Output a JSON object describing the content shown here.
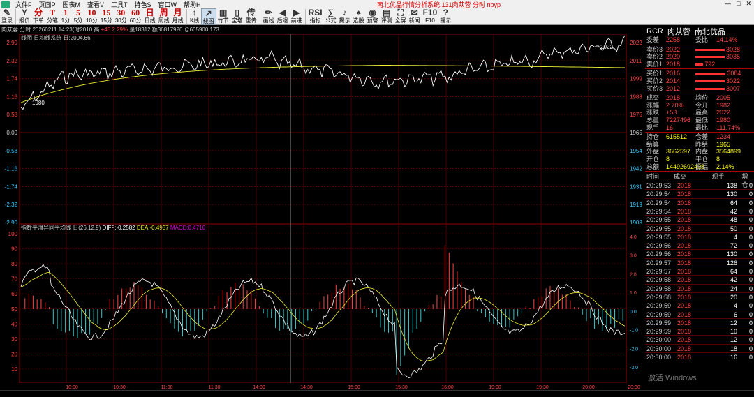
{
  "menu": [
    "文件F",
    "页面P",
    "图表M",
    "查看V",
    "工具T",
    "特色S",
    "窗口W",
    "帮助H"
  ],
  "window_title": "南北优品行情分析系统.131肉苁蓉 分时 nbyp",
  "toolbar": [
    {
      "g": "✎",
      "l": "登录"
    },
    {
      "g": "Y",
      "l": "报价"
    },
    {
      "g": "分",
      "l": "下单",
      "c": "red"
    },
    {
      "g": "T",
      "l": "分笔",
      "c": "red"
    },
    {
      "g": "1",
      "l": "1分",
      "c": "red"
    },
    {
      "g": "5",
      "l": "5分",
      "c": "red"
    },
    {
      "g": "10",
      "l": "10分",
      "c": "red"
    },
    {
      "g": "15",
      "l": "15分",
      "c": "red"
    },
    {
      "g": "30",
      "l": "30分",
      "c": "red"
    },
    {
      "g": "60",
      "l": "60分",
      "c": "red"
    },
    {
      "g": "日",
      "l": "日线",
      "c": "red"
    },
    {
      "g": "周",
      "l": "周线",
      "c": "red"
    },
    {
      "g": "月",
      "l": "月线",
      "c": "red"
    },
    {
      "g": "↕",
      "l": "K线"
    },
    {
      "g": "↗",
      "l": "线图",
      "a": 1
    },
    {
      "g": "▥",
      "l": "竹节"
    },
    {
      "g": "▯",
      "l": "宝塔"
    },
    {
      "g": "传",
      "l": "重传"
    },
    {
      "g": "✏",
      "l": "画线"
    },
    {
      "g": "◀",
      "l": "后退"
    },
    {
      "g": "▶",
      "l": "前进"
    },
    {
      "g": "RSI",
      "l": "指标"
    },
    {
      "g": "∑",
      "l": "公式"
    },
    {
      "g": "♪",
      "l": "提示"
    },
    {
      "g": "♠",
      "l": "选股"
    },
    {
      "g": "◉",
      "l": "预警"
    },
    {
      "g": "▤",
      "l": "评测"
    },
    {
      "g": "⛶",
      "l": "全屏"
    },
    {
      "g": "✉",
      "l": "新闻"
    },
    {
      "g": "F10",
      "l": "F10"
    },
    {
      "g": "?",
      "l": "提示"
    }
  ],
  "infobar": {
    "a": "肉苁蓉 分时  20260211 14:23(时2010 高",
    "b": "+45 2.29%",
    "c": "量18312 额36817920 仓605900 173"
  },
  "price_label": "线图 日均线系统 日:2004.66",
  "macd_label": {
    "a": "指数平滑异同平均线 日(26,12,9)",
    "diff": "DIFF:-0.2582",
    "dea": "DEA:-0.4937",
    "macd": "MACD:0.4710"
  },
  "left_axis": [
    "2.90",
    "2.32",
    "1.74",
    "1.16",
    "0.58",
    "0.00",
    "-0.58",
    "-1.16",
    "-1.74",
    "-2.32",
    "-2.90"
  ],
  "right_axis": [
    "2022",
    "2011",
    "1999",
    "1988",
    "1976",
    "1965",
    "1954",
    "1942",
    "1931",
    "1919",
    "1908"
  ],
  "macd_left": [
    "100",
    "90",
    "80",
    "70",
    "60",
    "50",
    "40",
    "30",
    "20",
    "10"
  ],
  "macd_right": [
    "4.0",
    "3.0",
    "2.0",
    "1.0",
    "0.0",
    "-1.0",
    "-2.0",
    "-3.0"
  ],
  "time_axis": [
    "10:00",
    "10:30",
    "11:00",
    "11:30",
    "14:00",
    "14:30",
    "15:00",
    "15:30",
    "16:00",
    "19:00",
    "19:30",
    "20:00",
    "20:30"
  ],
  "annotations": {
    "low": "1980",
    "high": "2022"
  },
  "colors": {
    "up": "#ff4444",
    "down": "#33cccc",
    "grid": "#8b0000",
    "avg": "#ffff33"
  },
  "quote": {
    "header": [
      "RCR",
      "肉苁蓉",
      "南北优品"
    ],
    "wei": [
      [
        "委差",
        "2258",
        "委比",
        "14.14%"
      ]
    ],
    "sells": [
      [
        "卖价3",
        "2022",
        "3028",
        60
      ],
      [
        "卖价2",
        "2020",
        "3035",
        60
      ],
      [
        "卖价1",
        "2018",
        "792",
        16
      ]
    ],
    "buys": [
      [
        "买价1",
        "2016",
        "3084",
        62
      ],
      [
        "买价2",
        "2014",
        "3022",
        60
      ],
      [
        "买价3",
        "2012",
        "3007",
        60
      ]
    ],
    "stats": [
      [
        "成交",
        "2018",
        "均价",
        "2005"
      ],
      [
        "涨幅",
        "2.70%",
        "今开",
        "1982"
      ],
      [
        "涨跌",
        "+53",
        "最高",
        "2022"
      ],
      [
        "总量",
        "7227496",
        "最低",
        "1980"
      ],
      [
        "现手",
        "16",
        "最比",
        "111.74%"
      ]
    ],
    "stats2": [
      [
        "持仓",
        "615512",
        "仓差",
        "1234"
      ],
      [
        "结算",
        "",
        "昨结",
        "1965"
      ],
      [
        "外盘",
        "3662597",
        "内盘",
        "3564899"
      ],
      [
        "开仓",
        "8",
        "平仓",
        "8"
      ],
      [
        "总额",
        "14492692408",
        "振幅",
        "2.14%"
      ]
    ]
  },
  "ticks": {
    "head": [
      "时间",
      "成交",
      "现手",
      "增仓"
    ],
    "rows": [
      [
        "20:29:53",
        "2018",
        "138",
        "0"
      ],
      [
        "20:29:54",
        "2018",
        "130",
        "0"
      ],
      [
        "20:29:54",
        "2018",
        "64",
        "0"
      ],
      [
        "20:29:54",
        "2018",
        "42",
        "0"
      ],
      [
        "20:29:55",
        "2018",
        "48",
        "0"
      ],
      [
        "20:29:55",
        "2018",
        "50",
        "0"
      ],
      [
        "20:29:55",
        "2018",
        "4",
        "0"
      ],
      [
        "20:29:56",
        "2018",
        "72",
        "0"
      ],
      [
        "20:29:56",
        "2018",
        "130",
        "0"
      ],
      [
        "20:29:57",
        "2018",
        "126",
        "0"
      ],
      [
        "20:29:57",
        "2018",
        "64",
        "0"
      ],
      [
        "20:29:58",
        "2018",
        "42",
        "0"
      ],
      [
        "20:29:58",
        "2018",
        "24",
        "0"
      ],
      [
        "20:29:58",
        "2018",
        "20",
        "0"
      ],
      [
        "20:29:59",
        "2018",
        "4",
        "0"
      ],
      [
        "20:29:59",
        "2018",
        "6",
        "0"
      ],
      [
        "20:29:59",
        "2018",
        "12",
        "0"
      ],
      [
        "20:29:59",
        "2018",
        "10",
        "0"
      ],
      [
        "20:30:00",
        "2018",
        "12",
        "0"
      ],
      [
        "20:30:00",
        "2018",
        "18",
        "0"
      ],
      [
        "20:30:00",
        "2018",
        "16",
        "0"
      ]
    ]
  },
  "watermark": "激活 Windows"
}
